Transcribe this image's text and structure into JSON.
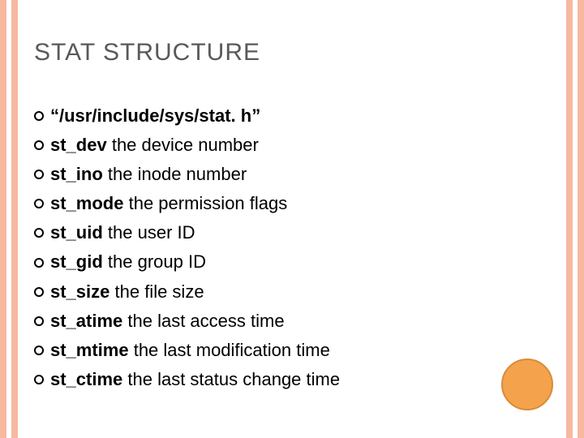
{
  "title": "STAT STRUCTURE",
  "items": [
    {
      "bold": "“/usr/include/sys/stat. h”",
      "desc": ""
    },
    {
      "bold": "st_dev",
      "desc": " the device number"
    },
    {
      "bold": "st_ino",
      "desc": " the inode number"
    },
    {
      "bold": "st_mode",
      "desc": " the permission flags"
    },
    {
      "bold": "st_uid",
      "desc": " the user ID"
    },
    {
      "bold": "st_gid",
      "desc": " the group ID"
    },
    {
      "bold": "st_size",
      "desc": " the file size"
    },
    {
      "bold": "st_atime",
      "desc": " the last access time"
    },
    {
      "bold": "st_mtime",
      "desc": " the last modification time"
    },
    {
      "bold": "st_ctime",
      "desc": " the last status change time"
    }
  ]
}
